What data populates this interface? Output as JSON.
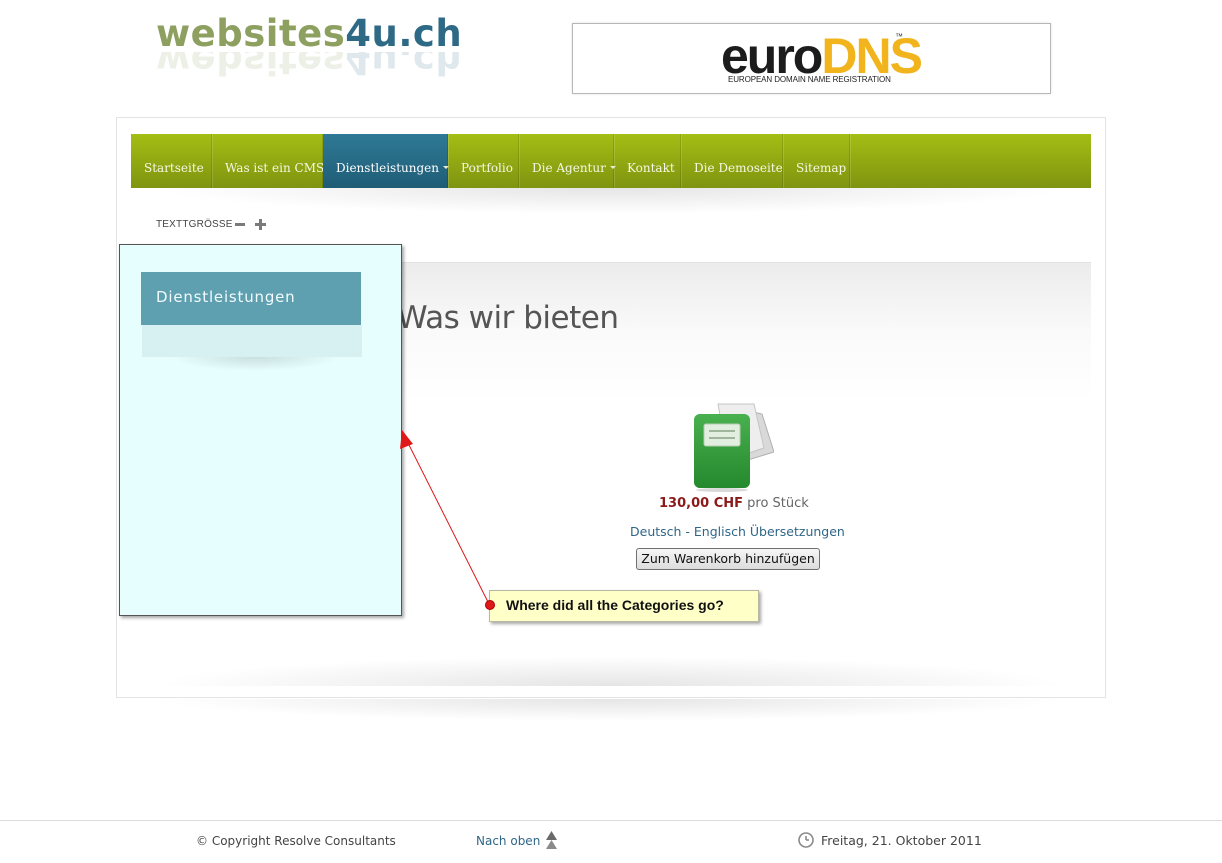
{
  "header": {
    "logo": {
      "part1": "websites",
      "part2": "4u.ch"
    },
    "banner": {
      "word1": "euro",
      "word2": "DNS",
      "tm": "™",
      "tagline": "EUROPEAN DOMAIN NAME REGISTRATION"
    }
  },
  "nav": {
    "items": [
      {
        "label": "Startseite"
      },
      {
        "label": "Was ist ein CMS?"
      },
      {
        "label": "Dienstleistungen",
        "active": true,
        "dropdown": true
      },
      {
        "label": "Portfolio"
      },
      {
        "label": "Die Agentur",
        "dropdown": true
      },
      {
        "label": "Kontakt"
      },
      {
        "label": "Die Demoseite"
      },
      {
        "label": "Sitemap"
      }
    ],
    "colors": {
      "bar": "#9db515",
      "active": "#2a6f8c"
    }
  },
  "textsize": {
    "label": "TEXTTGRÖSSE",
    "decrease_icon": "minus-icon",
    "increase_icon": "plus-icon"
  },
  "sidebar": {
    "heading": "Dienstleistungen"
  },
  "main": {
    "title": "Was wir bieten",
    "product": {
      "icon": "green-folder-icon",
      "price": "130,00 CHF",
      "unit": "pro Stück",
      "name": "Deutsch - Englisch Übersetzungen",
      "cart_button": "Zum Warenkorb hinzufügen"
    }
  },
  "annotation": {
    "text": "Where did all the Categories go?",
    "color": "#e01818"
  },
  "footer": {
    "copyright": "© Copyright Resolve Consultants",
    "back_to_top": "Nach oben",
    "date": "Freitag, 21. Oktober 2011"
  }
}
